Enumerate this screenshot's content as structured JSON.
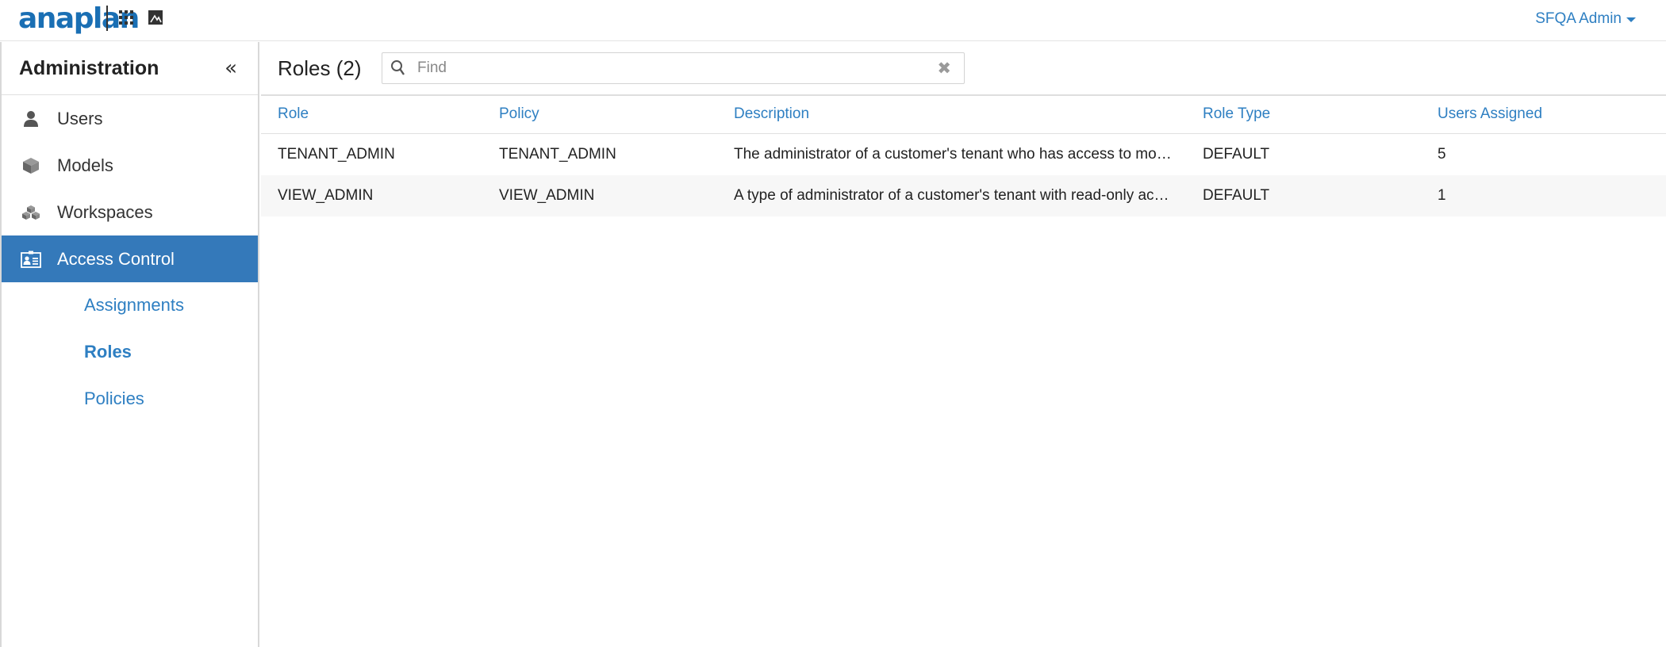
{
  "header": {
    "logo": "anaplan",
    "user_menu": "SFQA Admin"
  },
  "sidebar": {
    "title": "Administration",
    "items": [
      {
        "label": "Users",
        "icon": "user-icon"
      },
      {
        "label": "Models",
        "icon": "cube-icon"
      },
      {
        "label": "Workspaces",
        "icon": "workspaces-icon"
      },
      {
        "label": "Access Control",
        "icon": "id-card-icon",
        "active": true
      }
    ],
    "subitems": [
      {
        "label": "Assignments"
      },
      {
        "label": "Roles",
        "current": true
      },
      {
        "label": "Policies"
      }
    ]
  },
  "main": {
    "title": "Roles (2)",
    "search": {
      "placeholder": "Find",
      "value": ""
    },
    "columns": [
      "Role",
      "Policy",
      "Description",
      "Role Type",
      "Users Assigned"
    ],
    "rows": [
      {
        "role": "TENANT_ADMIN",
        "policy": "TENANT_ADMIN",
        "description": "The administrator of a customer's tenant who has access to mo…",
        "role_type": "DEFAULT",
        "users_assigned": "5"
      },
      {
        "role": "VIEW_ADMIN",
        "policy": "VIEW_ADMIN",
        "description": "A type of administrator of a customer's tenant with read-only ac…",
        "role_type": "DEFAULT",
        "users_assigned": "1"
      }
    ]
  },
  "colors": {
    "accent": "#2e7fc2",
    "active_bg": "#3479ba",
    "logo": "#1a6fb4"
  }
}
